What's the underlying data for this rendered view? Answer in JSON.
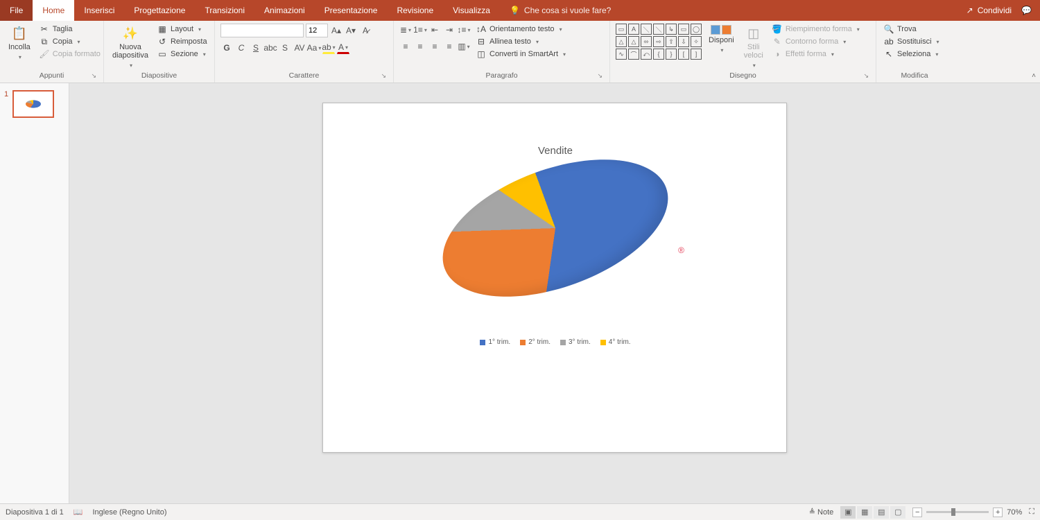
{
  "tabs": {
    "file": "File",
    "home": "Home",
    "insert": "Inserisci",
    "design": "Progettazione",
    "transitions": "Transizioni",
    "animations": "Animazioni",
    "slideshow": "Presentazione",
    "review": "Revisione",
    "view": "Visualizza",
    "tellme": "Che cosa si vuole fare?",
    "share": "Condividi"
  },
  "ribbon": {
    "clipboard": {
      "label": "Appunti",
      "paste": "Incolla",
      "cut": "Taglia",
      "copy": "Copia",
      "format_painter": "Copia formato"
    },
    "slides": {
      "label": "Diapositive",
      "new_slide": "Nuova\ndiapositiva",
      "layout": "Layout",
      "reset": "Reimposta",
      "section": "Sezione"
    },
    "font": {
      "label": "Carattere",
      "name": "",
      "size": "12"
    },
    "paragraph": {
      "label": "Paragrafo",
      "text_dir": "Orientamento testo",
      "align_text": "Allinea testo",
      "smartart": "Converti in SmartArt"
    },
    "drawing": {
      "label": "Disegno",
      "arrange": "Disponi",
      "quick_styles": "Stili\nveloci",
      "shape_fill": "Riempimento forma",
      "shape_outline": "Contorno forma",
      "shape_effects": "Effetti forma"
    },
    "editing": {
      "label": "Modifica",
      "find": "Trova",
      "replace": "Sostituisci",
      "select": "Seleziona"
    }
  },
  "thumb": {
    "number": "1"
  },
  "chart_data": {
    "type": "pie",
    "title": "Vendite",
    "series": [
      {
        "name": "1° trim.",
        "value": 58,
        "color": "#4472c4"
      },
      {
        "name": "2° trim.",
        "value": 22,
        "color": "#ed7d31"
      },
      {
        "name": "3° trim.",
        "value": 10,
        "color": "#a5a5a5"
      },
      {
        "name": "4° trim.",
        "value": 10,
        "color": "#ffc000"
      }
    ]
  },
  "status": {
    "slide_info": "Diapositiva 1 di 1",
    "language": "Inglese (Regno Unito)",
    "notes": "Note",
    "zoom": "70%"
  }
}
